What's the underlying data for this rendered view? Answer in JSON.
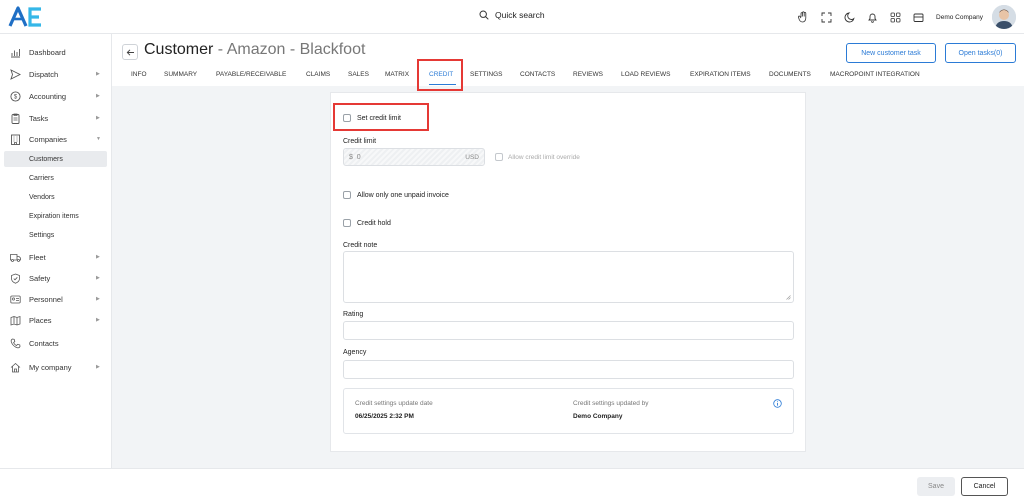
{
  "header": {
    "search_label": "Quick search",
    "company_name": "Demo Company"
  },
  "sidebar": {
    "items": [
      {
        "label": "Dashboard",
        "icon": "chart-icon",
        "arrow": false
      },
      {
        "label": "Dispatch",
        "icon": "send-icon",
        "arrow": true
      },
      {
        "label": "Accounting",
        "icon": "dollar-icon",
        "arrow": true
      },
      {
        "label": "Tasks",
        "icon": "clipboard-icon",
        "arrow": true
      },
      {
        "label": "Companies",
        "icon": "building-icon",
        "arrow": true,
        "expanded": true
      }
    ],
    "sub_items": [
      {
        "label": "Customers",
        "active": true
      },
      {
        "label": "Carriers"
      },
      {
        "label": "Vendors"
      },
      {
        "label": "Expiration items"
      },
      {
        "label": "Settings"
      }
    ],
    "items_after": [
      {
        "label": "Fleet",
        "icon": "truck-icon",
        "arrow": true
      },
      {
        "label": "Safety",
        "icon": "shield-icon",
        "arrow": true
      },
      {
        "label": "Personnel",
        "icon": "id-card-icon",
        "arrow": true
      },
      {
        "label": "Places",
        "icon": "map-icon",
        "arrow": true
      },
      {
        "label": "Contacts",
        "icon": "phone-icon",
        "arrow": false
      },
      {
        "label": "My company",
        "icon": "home-icon",
        "arrow": true
      }
    ]
  },
  "page": {
    "title_strong": "Customer",
    "title_rest": " - Amazon - Blackfoot",
    "new_task_label": "New customer task",
    "open_tasks_label": "Open tasks(0)"
  },
  "tabs": [
    "INFO",
    "SUMMARY",
    "PAYABLE/RECEIVABLE",
    "CLAIMS",
    "SALES",
    "MATRIX",
    "CREDIT",
    "SETTINGS",
    "CONTACTS",
    "REVIEWS",
    "LOAD REVIEWS",
    "EXPIRATION ITEMS",
    "DOCUMENTS",
    "MACROPOINT INTEGRATION"
  ],
  "active_tab": "CREDIT",
  "form": {
    "set_credit_limit_label": "Set credit limit",
    "credit_limit_label": "Credit limit",
    "credit_limit_prefix": "$",
    "credit_limit_value": "0",
    "credit_limit_currency": "USD",
    "override_label": "Allow credit limit override",
    "one_unpaid_label": "Allow only one unpaid invoice",
    "credit_hold_label": "Credit hold",
    "credit_note_label": "Credit note",
    "rating_label": "Rating",
    "agency_label": "Agency",
    "update_date_label": "Credit settings update date",
    "update_date_value": "06/25/2025 2:32 PM",
    "updated_by_label": "Credit settings updated by",
    "updated_by_value": "Demo Company"
  },
  "footer": {
    "save_label": "Save",
    "cancel_label": "Cancel"
  },
  "colors": {
    "accent": "#2b7bd6",
    "highlight": "#e53935"
  }
}
